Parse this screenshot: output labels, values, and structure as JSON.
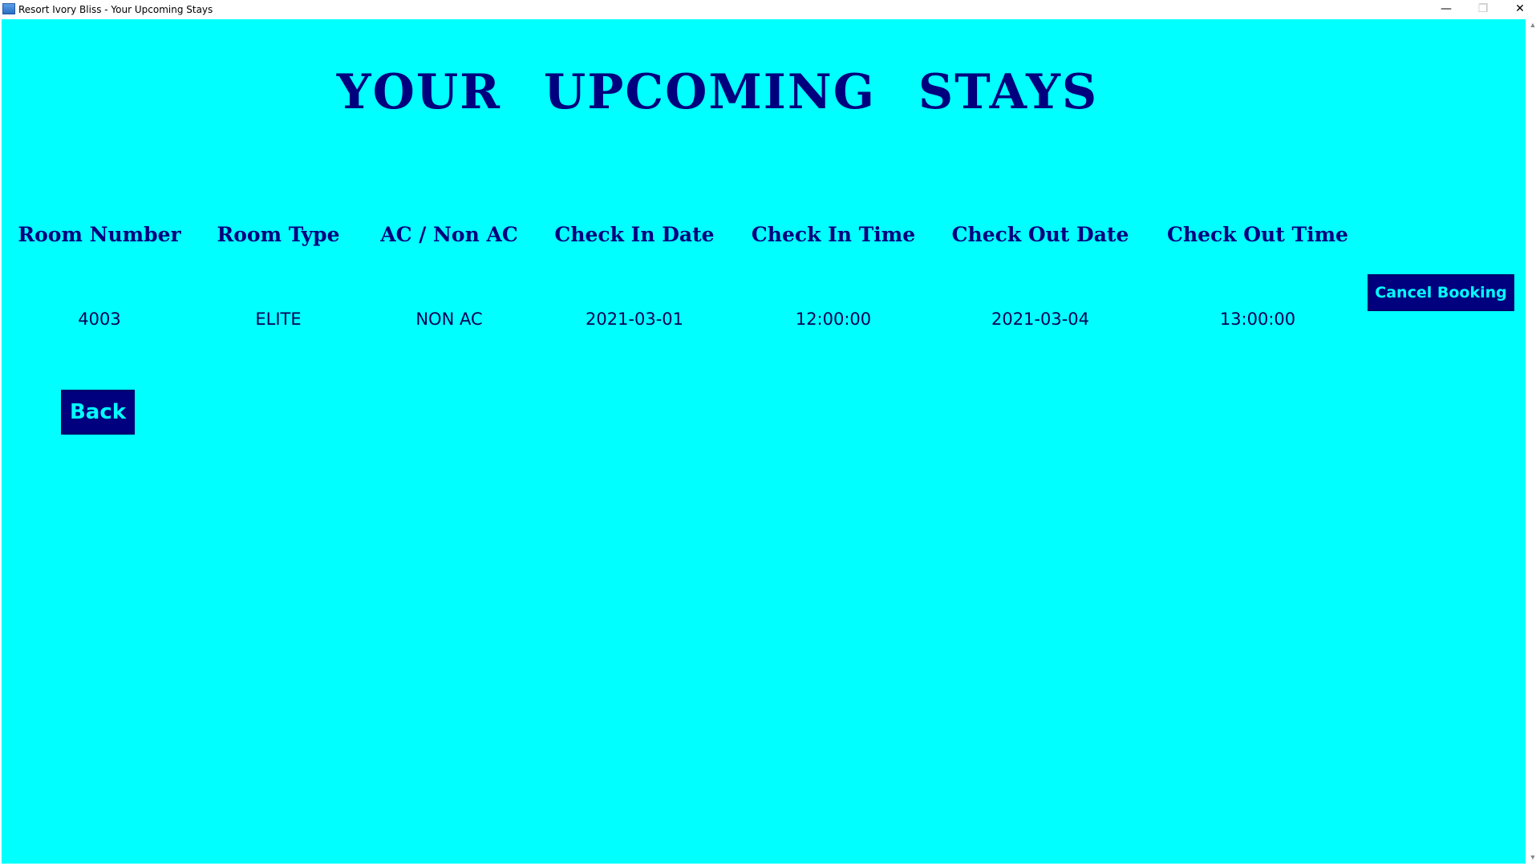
{
  "window": {
    "title": "Resort Ivory Bliss - Your Upcoming Stays",
    "controls": {
      "minimize": "—",
      "maximize": "❐",
      "close": "✕"
    }
  },
  "colors": {
    "background": "#00ffff",
    "accent": "#00007f",
    "button_text": "#00ffff"
  },
  "page": {
    "title": "YOUR UPCOMING STAYS"
  },
  "table": {
    "headers": [
      "Room Number",
      "Room Type",
      "AC / Non AC",
      "Check In Date",
      "Check In Time",
      "Check Out Date",
      "Check Out Time"
    ],
    "rows": [
      [
        "4003",
        "ELITE",
        "NON AC",
        "2021-03-01",
        "12:00:00",
        "2021-03-04",
        "13:00:00"
      ]
    ]
  },
  "buttons": {
    "cancel_booking": "Cancel Booking",
    "back": "Back"
  }
}
